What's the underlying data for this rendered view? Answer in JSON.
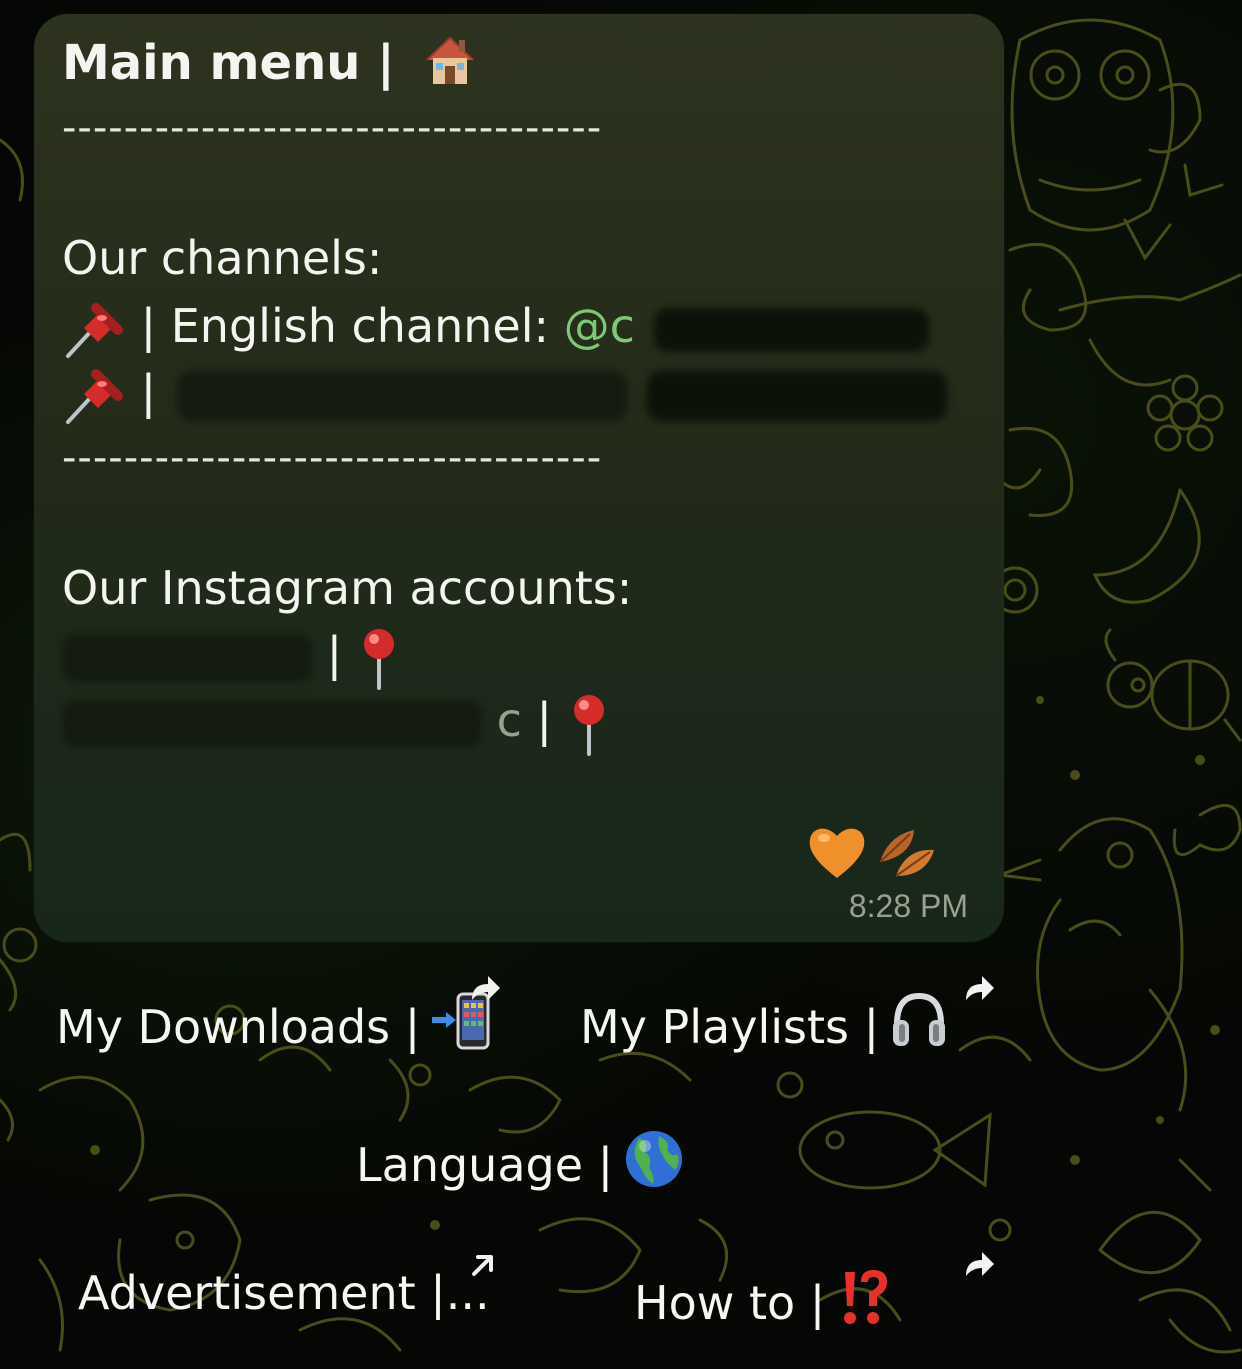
{
  "message": {
    "title": "Main menu |",
    "separator": "-----------------------------------",
    "channels_label": "Our channels:",
    "english_channel_prefix": "| English channel:",
    "english_channel_mention": "@c",
    "second_channel_prefix": "|",
    "instagram_label": "Our Instagram accounts:",
    "instagram_1_suffix": "|",
    "instagram_2_visible": "c",
    "instagram_2_suffix": "|",
    "time": "8:28 PM",
    "reactions": [
      "orange-heart-icon",
      "fallen-leaf-icon"
    ]
  },
  "keyboard": {
    "my_downloads": "My Downloads |",
    "my_playlists": "My Playlists |",
    "language": "Language |",
    "advertisement": "Advertisement |...",
    "how_to": "How to |"
  },
  "icons": {
    "title_emoji": "house-icon",
    "pin": "pushpin-icon",
    "round_pin": "round-pushpin-icon",
    "downloads_emoji": "mobile-arrow-icon",
    "playlists_emoji": "headphones-icon",
    "language_emoji": "globe-icon",
    "howto_emoji": "interrobang-icon"
  },
  "colors": {
    "mention": "#7dc777",
    "bubble": "#2d331f",
    "timestamp": "#9aa08f"
  }
}
